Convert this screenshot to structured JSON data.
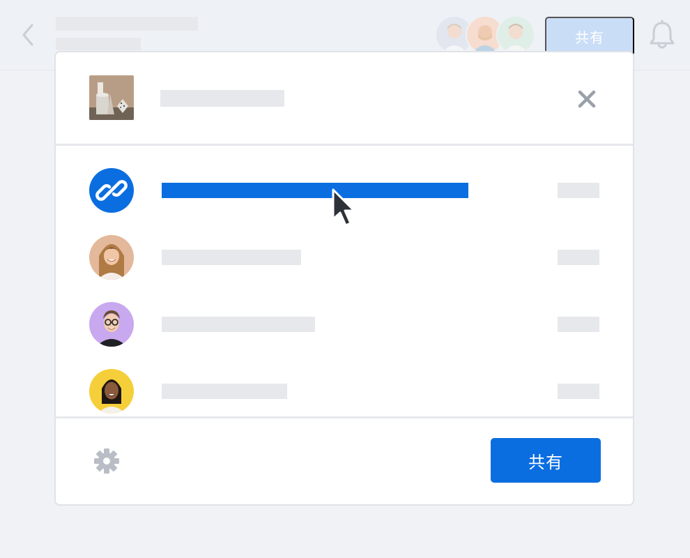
{
  "header": {
    "share_label": "共有"
  },
  "dialog": {
    "share_label": "共有",
    "rows": [
      {
        "kind": "link",
        "selected": true
      },
      {
        "kind": "person"
      },
      {
        "kind": "person"
      },
      {
        "kind": "person"
      }
    ]
  },
  "colors": {
    "accent": "#0b6ee0",
    "placeholder": "#e6e8ec",
    "background": "#f0f2f6"
  },
  "icons": [
    "back-chevron-icon",
    "bell-icon",
    "close-icon",
    "link-icon",
    "gear-icon",
    "mouse-cursor-icon"
  ]
}
